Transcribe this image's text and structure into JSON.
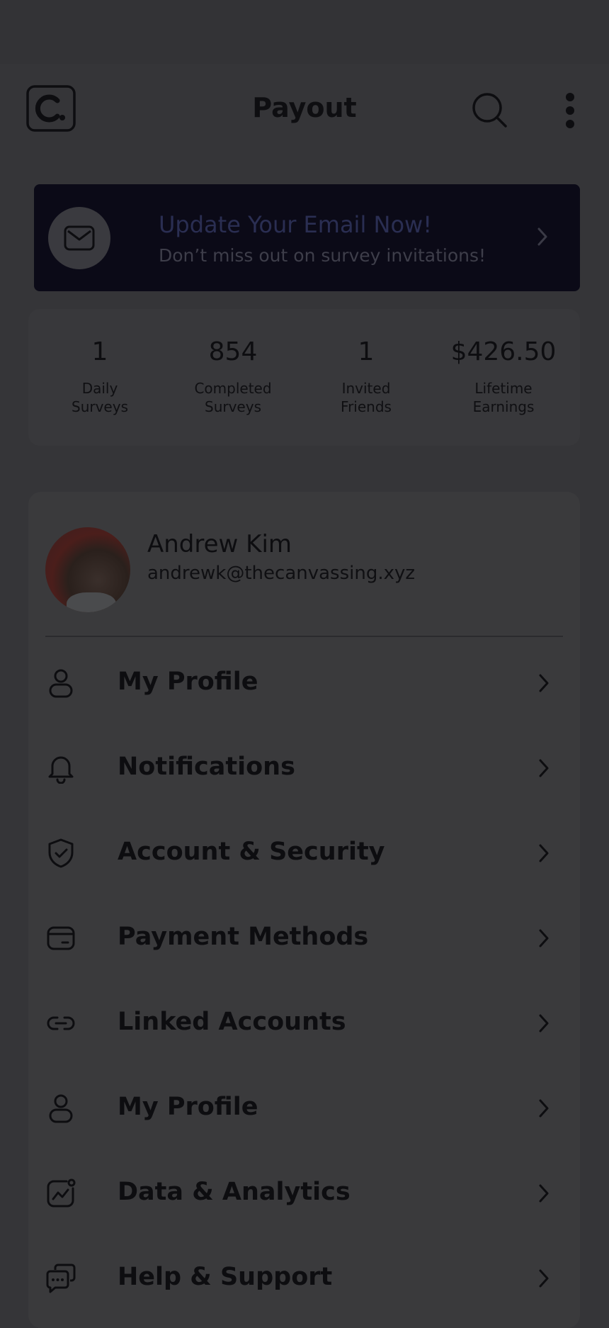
{
  "header": {
    "title": "Payout",
    "logo_icon": "app-logo",
    "search_icon": "search-icon",
    "more_icon": "more-vertical-icon"
  },
  "banner": {
    "title": "Update Your Email Now!",
    "subtitle": "Don’t miss out on survey invitations!",
    "icon": "mail-icon"
  },
  "stats": [
    {
      "value": "1",
      "label_line1": "Daily",
      "label_line2": "Surveys"
    },
    {
      "value": "854",
      "label_line1": "Completed",
      "label_line2": "Surveys"
    },
    {
      "value": "1",
      "label_line1": "Invited",
      "label_line2": "Friends"
    },
    {
      "value": "$426.50",
      "label_line1": "Lifetime",
      "label_line2": "Earnings"
    }
  ],
  "profile": {
    "name": "Andrew Kim",
    "email": "andrewk@thecanvassing.xyz"
  },
  "menu": [
    {
      "label": "My Profile",
      "icon": "user-icon"
    },
    {
      "label": "Notifications",
      "icon": "bell-icon"
    },
    {
      "label": "Account & Security",
      "icon": "shield-check-icon"
    },
    {
      "label": "Payment Methods",
      "icon": "card-icon"
    },
    {
      "label": "Linked Accounts",
      "icon": "link-icon"
    },
    {
      "label": "My Profile",
      "icon": "user-icon"
    },
    {
      "label": "Data & Analytics",
      "icon": "analytics-icon"
    },
    {
      "label": "Help & Support",
      "icon": "support-chat-icon"
    }
  ],
  "colors": {
    "overlay": "#353538",
    "banner_bg": "#0b0a17",
    "banner_title": "#2a2e52"
  }
}
